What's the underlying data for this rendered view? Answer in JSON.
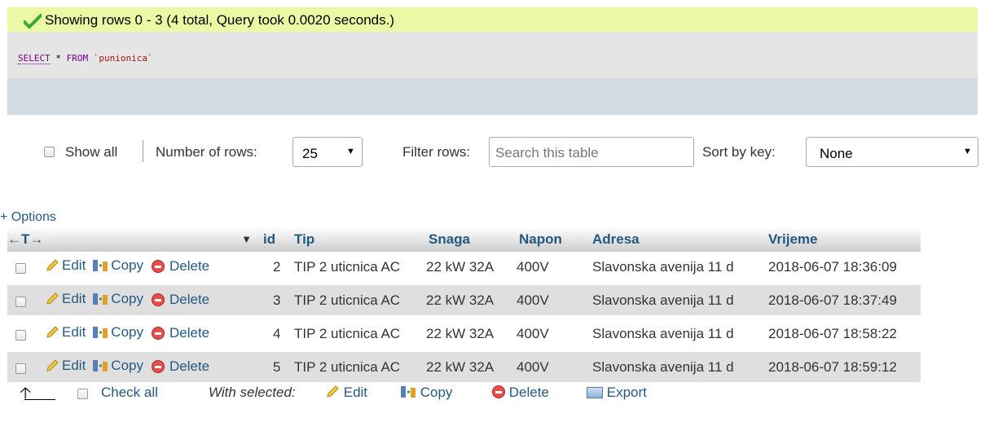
{
  "success": {
    "message": "Showing rows 0 - 3 (4 total, Query took 0.0020 seconds.)"
  },
  "sql": {
    "select": "SELECT",
    "star": "*",
    "from": "FROM",
    "table": "`punionica`"
  },
  "nav": {
    "show_all": "Show all",
    "number_of_rows_label": "Number of rows:",
    "rows_value": "25",
    "filter_label": "Filter rows:",
    "filter_placeholder": "Search this table",
    "sort_label": "Sort by key:",
    "sort_value": "None"
  },
  "options_label": "+ Options",
  "table": {
    "arrows": "←T→",
    "sort_arrow": "▼",
    "columns": [
      "id",
      "Tip",
      "Snaga",
      "Napon",
      "Adresa",
      "Vrijeme"
    ],
    "actions": {
      "edit": "Edit",
      "copy": "Copy",
      "delete": "Delete"
    },
    "rows": [
      {
        "id": "2",
        "tip": "TIP 2 uticnica AC",
        "snaga": "22 kW 32A",
        "napon": "400V",
        "adresa": "Slavonska avenija 11 d",
        "vrijeme": "2018-06-07 18:36:09"
      },
      {
        "id": "3",
        "tip": "TIP 2 uticnica AC",
        "snaga": "22 kW 32A",
        "napon": "400V",
        "adresa": "Slavonska avenija 11 d",
        "vrijeme": "2018-06-07 18:37:49"
      },
      {
        "id": "4",
        "tip": "TIP 2 uticnica AC",
        "snaga": "22 kW 32A",
        "napon": "400V",
        "adresa": "Slavonska avenija 11 d",
        "vrijeme": "2018-06-07 18:58:22"
      },
      {
        "id": "5",
        "tip": "TIP 2 uticnica AC",
        "snaga": "22 kW 32A",
        "napon": "400V",
        "adresa": "Slavonska avenija 11 d",
        "vrijeme": "2018-06-07 18:59:12"
      }
    ]
  },
  "bottom": {
    "check_all": "Check all",
    "with_selected": "With selected:",
    "edit": "Edit",
    "copy": "Copy",
    "delete": "Delete",
    "export": "Export"
  },
  "colors": {
    "success_bg": "#ebf8a4",
    "link": "#235a81",
    "row_alt": "#dfdfdf",
    "sql_bg": "#e5e5e5"
  }
}
